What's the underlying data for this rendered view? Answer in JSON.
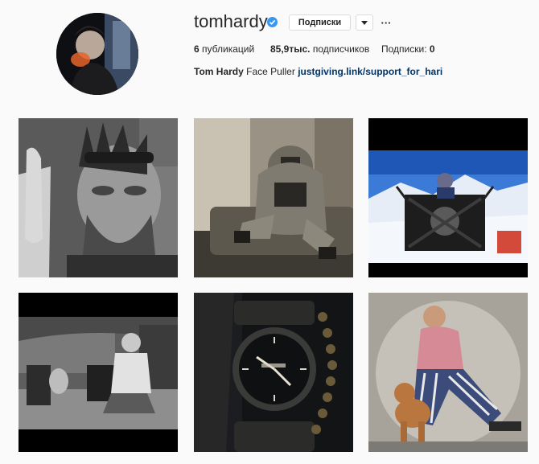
{
  "profile": {
    "username": "tomhardy",
    "follow_label": "Подписки",
    "dropdown_icon": "chevron-down-icon",
    "more_icon": "ellipsis-icon",
    "more_label": "···",
    "posts_count": "6",
    "posts_label": "публикаций",
    "followers_count": "85,9тыс.",
    "followers_label": "подписчиков",
    "following_label": "Подписки:",
    "following_count": "0",
    "bio_name": "Tom Hardy",
    "bio_text": "Face Puller",
    "bio_link": "justgiving.link/support_for_hari",
    "verified_color": "#3897f0"
  },
  "posts": [
    {
      "subject": "man with mohawk and sunglasses, black and white"
    },
    {
      "subject": "man in hoodie sitting on sofa, sepia"
    },
    {
      "subject": "climber with flag on snowy mountain summit"
    },
    {
      "subject": "man sitting in chair with dog outside brick building"
    },
    {
      "subject": "wristwatch close-up on dark background"
    },
    {
      "subject": "man in striped trousers seated with dog"
    }
  ]
}
